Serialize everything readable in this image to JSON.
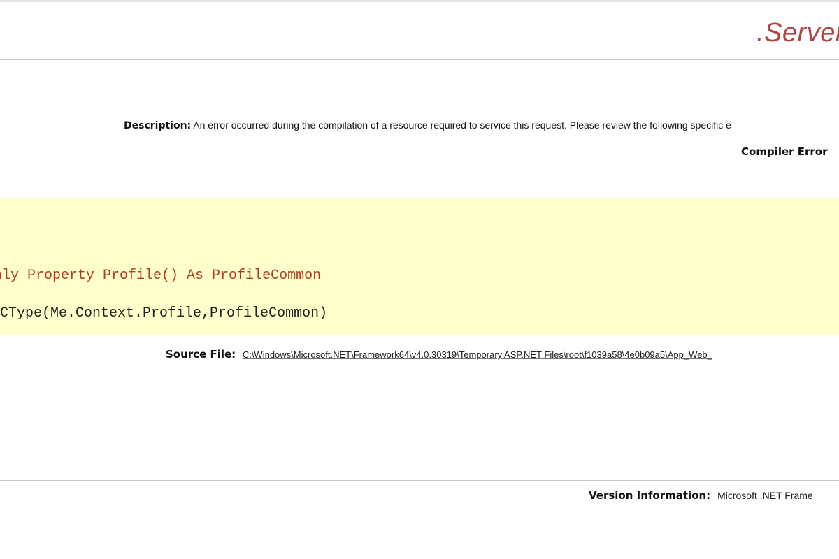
{
  "header": {
    "title": ".Server"
  },
  "description": {
    "label": "Description:",
    "text": "An error occurred during the compilation of a resource required to service this request. Please review the following specific e"
  },
  "compiler_error": {
    "label": "Compiler Error"
  },
  "code": {
    "lines": [
      "nly Property Profile() As ProfileCommon",
      "CType(Me.Context.Profile,ProfileCommon)"
    ],
    "colors": {
      "highlight_background": "#ffffcc",
      "error_line": "#b33a1e"
    }
  },
  "source_file": {
    "label": "Source File:",
    "path": "C:\\Windows\\Microsoft.NET\\Framework64\\v4.0.30319\\Temporary ASP.NET Files\\root\\f1039a58\\4e0b09a5\\App_Web_"
  },
  "version_info": {
    "label": "Version Information:",
    "text": "Microsoft .NET Frame"
  },
  "theme": {
    "title_color": "#b44444",
    "rule_color": "#c8c8c8"
  }
}
